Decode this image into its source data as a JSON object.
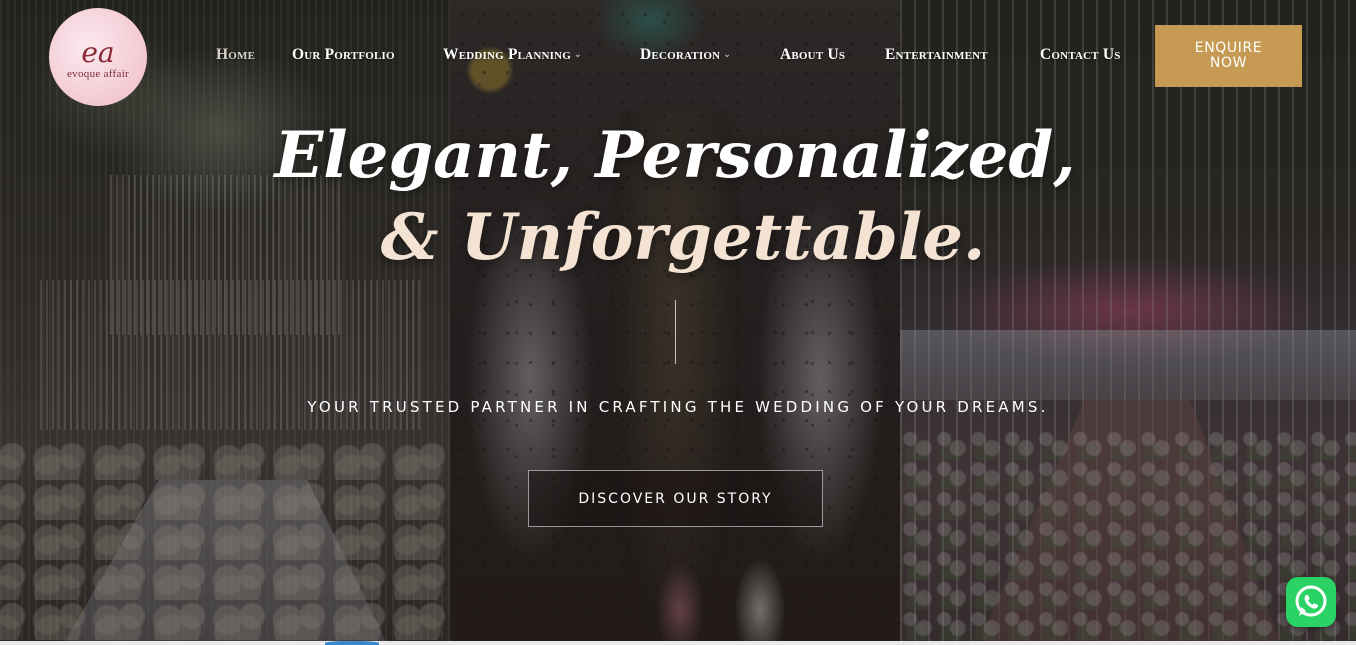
{
  "brand": {
    "logo_mark": "ea",
    "logo_text": "evoque affair"
  },
  "nav": {
    "items": [
      {
        "label": "Home",
        "active": true,
        "has_dropdown": false
      },
      {
        "label": "Our Portfolio",
        "active": false,
        "has_dropdown": false
      },
      {
        "label": "Wedding Planning",
        "active": false,
        "has_dropdown": true
      },
      {
        "label": "Decoration",
        "active": false,
        "has_dropdown": true
      },
      {
        "label": "About Us",
        "active": false,
        "has_dropdown": false
      },
      {
        "label": "Entertainment",
        "active": false,
        "has_dropdown": false
      },
      {
        "label": "Contact Us",
        "active": false,
        "has_dropdown": false
      }
    ],
    "enquire_line1": "ENQUIRE",
    "enquire_line2": "NOW"
  },
  "hero": {
    "headline_line1": "Elegant, Personalized,",
    "headline_line2": "& Unforgettable.",
    "tagline": "YOUR TRUSTED PARTNER IN CRAFTING THE WEDDING OF YOUR DREAMS.",
    "cta_label": "DISCOVER OUR STORY"
  },
  "floating": {
    "whatsapp_icon": "whatsapp-icon"
  },
  "colors": {
    "accent": "#c69a52",
    "whatsapp": "#2bd366",
    "logo_bg": "#f3c9d3"
  }
}
